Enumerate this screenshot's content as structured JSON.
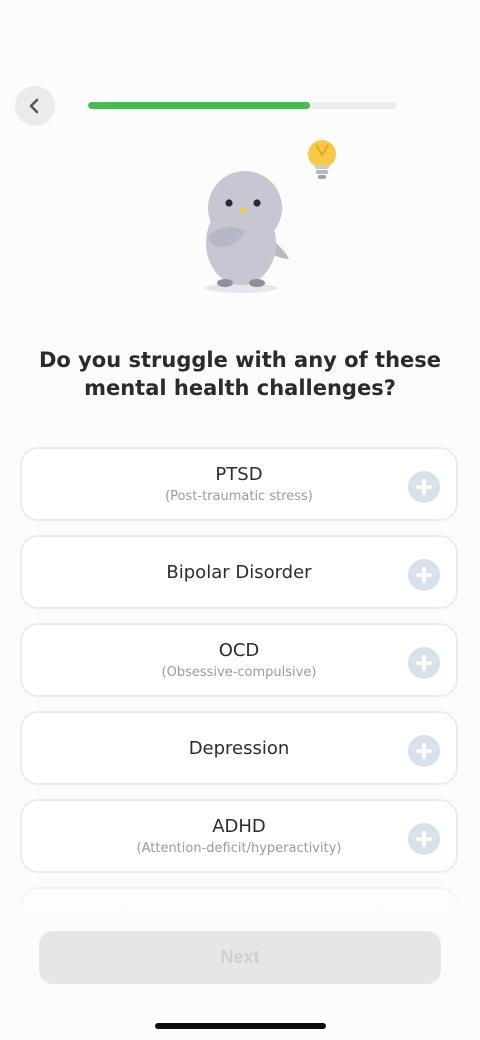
{
  "header": {
    "back_icon": "chevron-left-icon",
    "progress": 0.72
  },
  "mascot": {
    "icons": [
      "penguin-mascot-icon",
      "lightbulb-icon"
    ]
  },
  "question": {
    "line1": "Do you struggle with any of these",
    "line2": "mental health challenges?"
  },
  "options": [
    {
      "title": "PTSD",
      "subtitle": "(Post-traumatic stress)"
    },
    {
      "title": "Bipolar Disorder",
      "subtitle": ""
    },
    {
      "title": "OCD",
      "subtitle": "(Obsessive-compulsive)"
    },
    {
      "title": "Depression",
      "subtitle": ""
    },
    {
      "title": "ADHD",
      "subtitle": "(Attention-deficit/hyperactivity)"
    }
  ],
  "footer": {
    "next_label": "Next"
  },
  "colors": {
    "progress_fill": "#4cb85c",
    "plus_circle": "#d9e2ea",
    "next_disabled": "#e6e6e8"
  }
}
